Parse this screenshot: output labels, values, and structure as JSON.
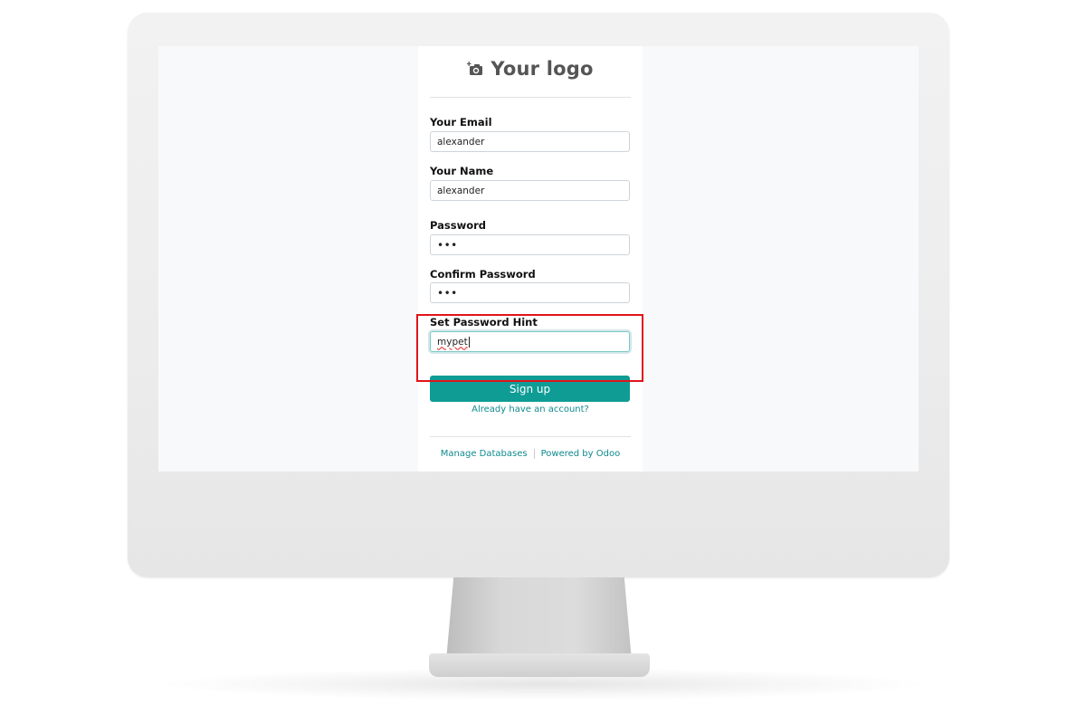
{
  "logo": {
    "icon": "camera-plus-icon",
    "text": "Your logo"
  },
  "form": {
    "email": {
      "label": "Your Email",
      "value": "alexander"
    },
    "name": {
      "label": "Your Name",
      "value": "alexander"
    },
    "password": {
      "label": "Password",
      "value": "•••"
    },
    "confirm_password": {
      "label": "Confirm Password",
      "value": "•••"
    },
    "password_hint": {
      "label": "Set Password Hint",
      "value": "mypet"
    },
    "signup_label": "Sign up",
    "already_account_label": "Already have an account?"
  },
  "footer": {
    "manage_databases": "Manage Databases",
    "powered_by": "Powered by Odoo"
  },
  "colors": {
    "primary": "#0f9c95",
    "link": "#0f8a8e",
    "highlight": "#e0141c"
  }
}
